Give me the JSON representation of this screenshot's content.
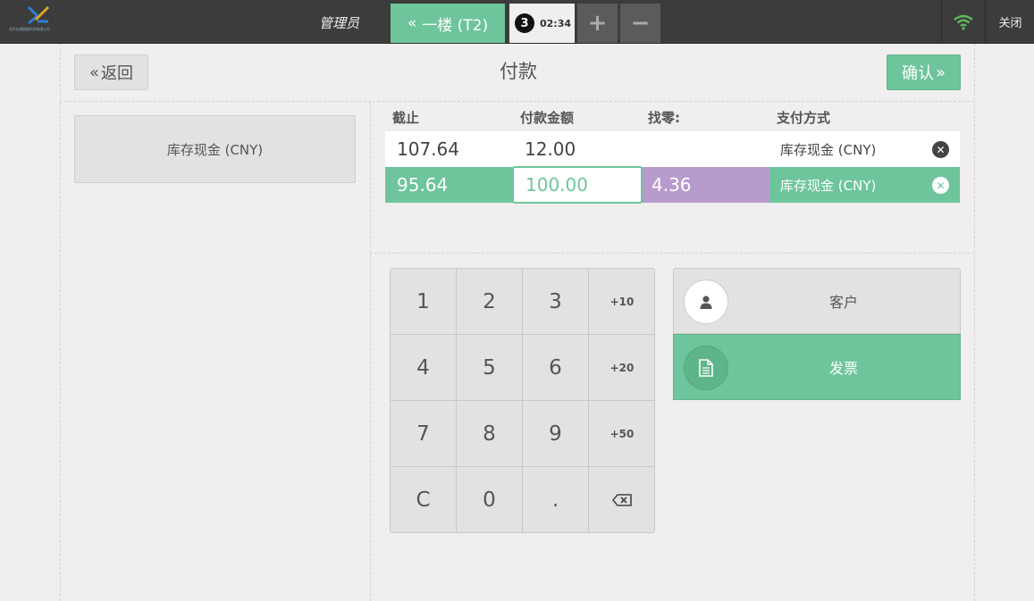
{
  "topbar": {
    "logo_small_text": "北京长城智能科技有限公司",
    "admin_label": "管理员",
    "floor_button": "一楼 (T2)",
    "order_number": "3",
    "order_time": "02:34",
    "add_icon": "plus-icon",
    "remove_icon": "minus-icon",
    "wifi_icon": "wifi-icon",
    "close_label": "关闭",
    "accent": "#6ec59b"
  },
  "header": {
    "back_label": "返回",
    "title": "付款",
    "confirm_label": "确认"
  },
  "methods": [
    "库存现金 (CNY)"
  ],
  "table": {
    "headers": [
      "截止",
      "付款金额",
      "找零:",
      "支付方式"
    ],
    "rows": [
      {
        "due": "107.64",
        "tendered": "12.00",
        "change": "",
        "method": "库存现金 (CNY)"
      },
      {
        "due": "95.64",
        "tendered": "100.00",
        "change": "4.36",
        "method": "库存现金 (CNY)"
      }
    ]
  },
  "numpad": {
    "keys": [
      "1",
      "2",
      "3",
      "+10",
      "4",
      "5",
      "6",
      "+20",
      "7",
      "8",
      "9",
      "+50",
      "C",
      "0",
      ".",
      "backspace"
    ]
  },
  "side": {
    "customer_label": "客户",
    "invoice_label": "发票"
  },
  "colors": {
    "green": "#6ec59b",
    "purple": "#b89bcd",
    "topbar": "#3c3c3c"
  }
}
